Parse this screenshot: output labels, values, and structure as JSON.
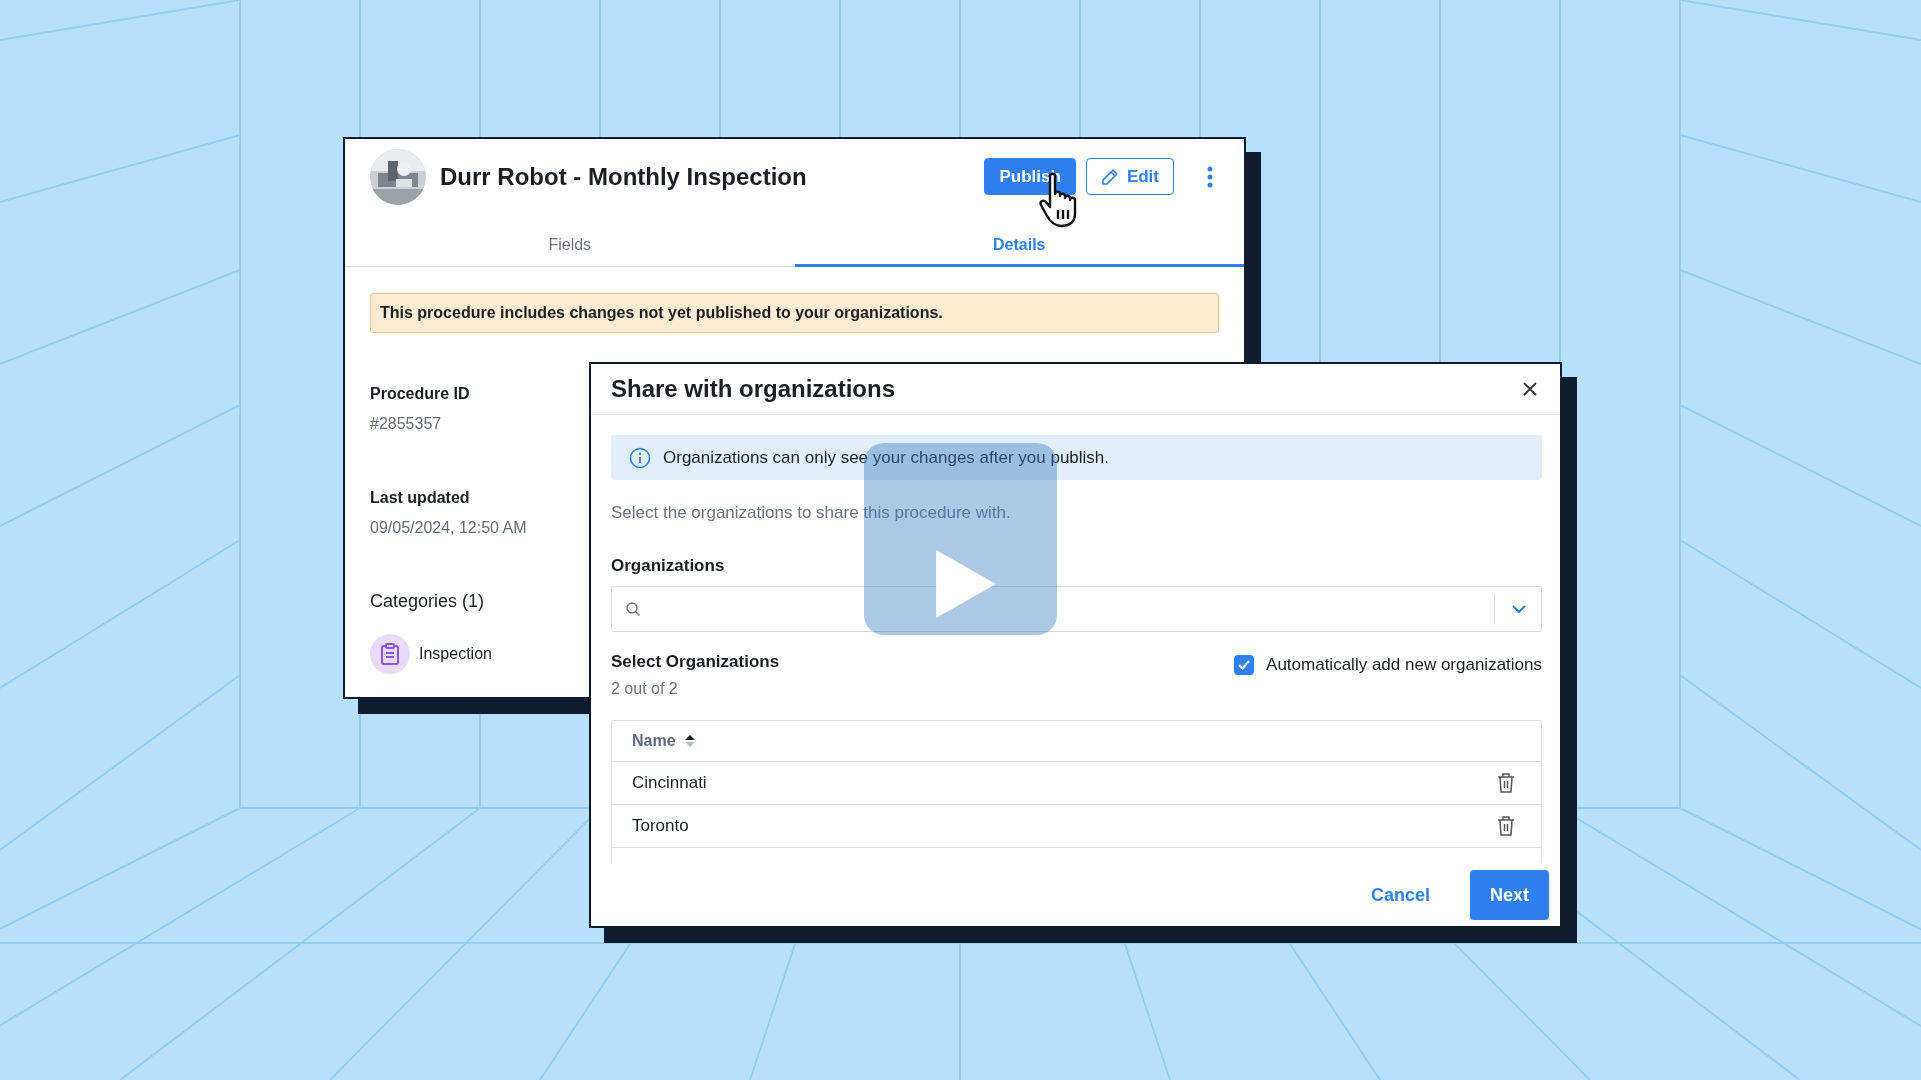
{
  "procedure": {
    "title": "Durr Robot - Monthly Inspection",
    "actions": [
      {
        "label": "Publish",
        "kind": "primary"
      },
      {
        "label": "Edit",
        "kind": "outline"
      }
    ],
    "tabs": [
      {
        "label": "Fields",
        "selected": false
      },
      {
        "label": "Details",
        "selected": true
      }
    ],
    "banner": "This procedure includes changes not yet published to your organizations.",
    "details": [
      {
        "label": "Procedure ID",
        "value": "#2855357"
      },
      {
        "label": "Last updated",
        "value": "09/05/2024, 12:50 AM"
      }
    ],
    "categories": {
      "heading": "Categories (1)",
      "items": [
        {
          "label": "Inspection"
        }
      ]
    }
  },
  "dialog": {
    "title": "Share with organizations",
    "info": "Organizations can only see your changes after you publish.",
    "instruction": "Select the organizations to share this procedure with.",
    "field_label": "Organizations",
    "section_title": "Select Organizations",
    "count": "2 out of 2",
    "auto_add": {
      "label": "Automatically add new organizations",
      "checked": true
    },
    "table": {
      "columns": [
        {
          "label": "Name"
        }
      ],
      "rows": [
        {
          "name": "Cincinnati"
        },
        {
          "name": "Toronto"
        }
      ]
    },
    "buttons": [
      {
        "label": "Cancel",
        "kind": "text"
      },
      {
        "label": "Next",
        "kind": "primary"
      }
    ]
  }
}
